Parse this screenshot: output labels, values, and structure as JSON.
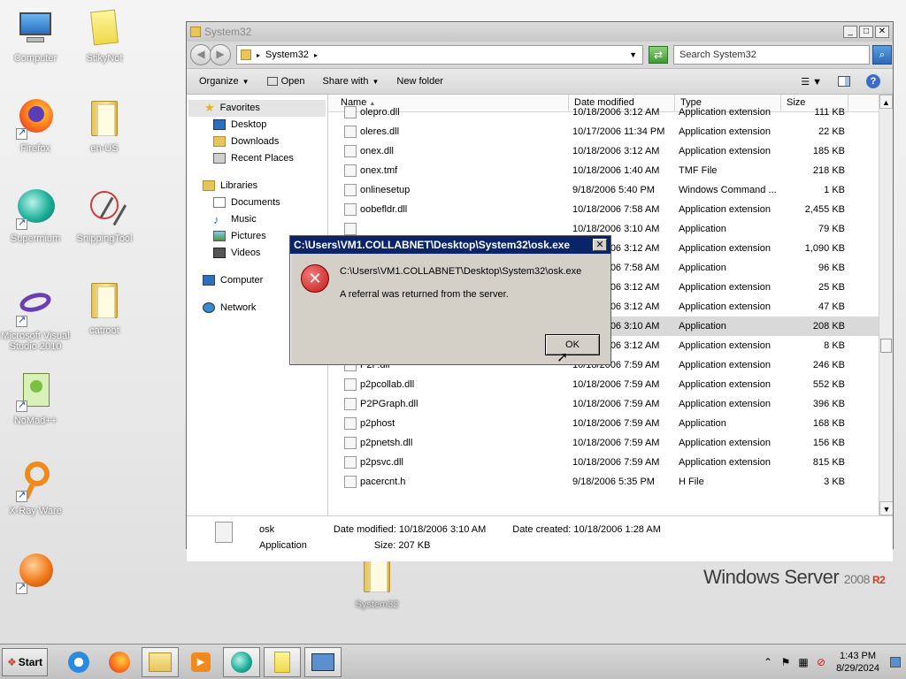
{
  "desktop": {
    "icons": [
      {
        "label": "Computer"
      },
      {
        "label": "StikyNot"
      },
      {
        "label": "Firefox"
      },
      {
        "label": "en-US"
      },
      {
        "label": "Supermium"
      },
      {
        "label": "SnippingTool"
      },
      {
        "label": "Microsoft Visual Studio 2010"
      },
      {
        "label": "catroot"
      },
      {
        "label": "NoMad++"
      },
      {
        "label": "X-Ray Ware"
      },
      {
        "label": ""
      },
      {
        "label": "System32"
      }
    ],
    "brand": {
      "name": "Windows Server",
      "version": "2008",
      "edition": "R2"
    }
  },
  "explorer": {
    "title": "System32",
    "address_path": "System32",
    "search_placeholder": "Search System32",
    "toolbar": {
      "organize": "Organize",
      "open": "Open",
      "share_with": "Share with",
      "new_folder": "New folder"
    },
    "nav": {
      "favorites": "Favorites",
      "favorites_items": [
        "Desktop",
        "Downloads",
        "Recent Places"
      ],
      "libraries": "Libraries",
      "libraries_items": [
        "Documents",
        "Music",
        "Pictures",
        "Videos"
      ],
      "computer": "Computer",
      "network": "Network"
    },
    "columns": {
      "name": "Name",
      "date": "Date modified",
      "type": "Type",
      "size": "Size"
    },
    "rows": [
      {
        "name": "olepro.dll",
        "date": "10/18/2006 3:12 AM",
        "type": "Application extension",
        "size": "111 KB"
      },
      {
        "name": "oleres.dll",
        "date": "10/17/2006 11:34 PM",
        "type": "Application extension",
        "size": "22 KB"
      },
      {
        "name": "onex.dll",
        "date": "10/18/2006 3:12 AM",
        "type": "Application extension",
        "size": "185 KB"
      },
      {
        "name": "onex.tmf",
        "date": "10/18/2006 1:40 AM",
        "type": "TMF File",
        "size": "218 KB"
      },
      {
        "name": "onlinesetup",
        "date": "9/18/2006 5:40 PM",
        "type": "Windows Command ...",
        "size": "1 KB"
      },
      {
        "name": "oobefldr.dll",
        "date": "10/18/2006 7:58 AM",
        "type": "Application extension",
        "size": "2,455 KB"
      },
      {
        "name": "",
        "date": "10/18/2006 3:10 AM",
        "type": "Application",
        "size": "79 KB"
      },
      {
        "name": "",
        "date": "10/18/2006 3:12 AM",
        "type": "Application extension",
        "size": "1,090 KB"
      },
      {
        "name": "",
        "date": "10/18/2006 7:58 AM",
        "type": "Application",
        "size": "96 KB"
      },
      {
        "name": "",
        "date": "10/18/2006 3:12 AM",
        "type": "Application extension",
        "size": "25 KB"
      },
      {
        "name": "",
        "date": "10/18/2006 3:12 AM",
        "type": "Application extension",
        "size": "47 KB"
      },
      {
        "name": "",
        "date": "10/18/2006 3:10 AM",
        "type": "Application",
        "size": "208 KB"
      },
      {
        "name": "",
        "date": "10/18/2006 3:12 AM",
        "type": "Application extension",
        "size": "8 KB"
      },
      {
        "name": "P2P.dll",
        "date": "10/18/2006 7:59 AM",
        "type": "Application extension",
        "size": "246 KB"
      },
      {
        "name": "p2pcollab.dll",
        "date": "10/18/2006 7:59 AM",
        "type": "Application extension",
        "size": "552 KB"
      },
      {
        "name": "P2PGraph.dll",
        "date": "10/18/2006 7:59 AM",
        "type": "Application extension",
        "size": "396 KB"
      },
      {
        "name": "p2phost",
        "date": "10/18/2006 7:59 AM",
        "type": "Application",
        "size": "168 KB"
      },
      {
        "name": "p2pnetsh.dll",
        "date": "10/18/2006 7:59 AM",
        "type": "Application extension",
        "size": "156 KB"
      },
      {
        "name": "p2psvc.dll",
        "date": "10/18/2006 7:59 AM",
        "type": "Application extension",
        "size": "815 KB"
      },
      {
        "name": "pacercnt.h",
        "date": "9/18/2006 5:35 PM",
        "type": "H File",
        "size": "3 KB"
      }
    ],
    "details": {
      "name": "osk",
      "type": "Application",
      "modified_label": "Date modified:",
      "modified": "10/18/2006 3:10 AM",
      "size_label": "Size:",
      "size": "207 KB",
      "created_label": "Date created:",
      "created": "10/18/2006 1:28 AM"
    }
  },
  "dialog": {
    "title": "C:\\Users\\VM1.COLLABNET\\Desktop\\System32\\osk.exe",
    "path": "C:\\Users\\VM1.COLLABNET\\Desktop\\System32\\osk.exe",
    "message": "A referral was returned from the server.",
    "ok": "OK",
    "close": "✕"
  },
  "taskbar": {
    "start": "Start",
    "time": "1:43 PM",
    "date": "8/29/2024"
  }
}
